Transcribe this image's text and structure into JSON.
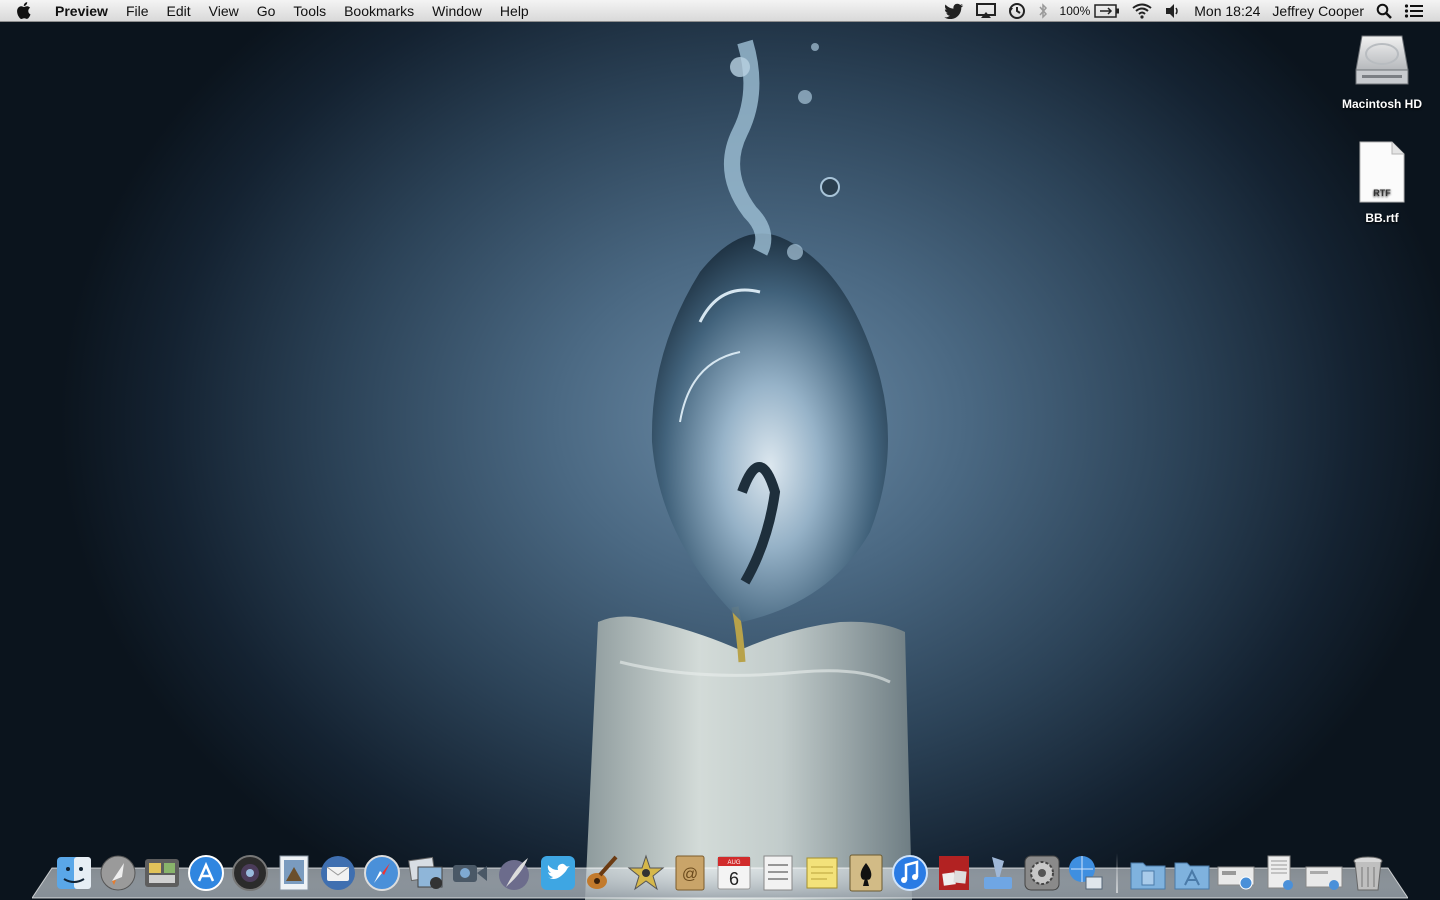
{
  "menubar": {
    "app_name": "Preview",
    "menus": [
      "File",
      "Edit",
      "View",
      "Go",
      "Tools",
      "Bookmarks",
      "Window",
      "Help"
    ],
    "status": {
      "battery_percent": "100%",
      "clock": "Mon 18:24",
      "user": "Jeffrey Cooper"
    },
    "status_icons": [
      "twitter-icon",
      "airplay-icon",
      "time-machine-icon",
      "bluetooth-icon",
      "battery-icon",
      "wifi-icon",
      "volume-icon",
      "spotlight-icon",
      "notification-list-icon"
    ]
  },
  "desktop": {
    "icons": [
      {
        "label": "Macintosh HD",
        "icon": "hard-drive-icon"
      },
      {
        "label": "BB.rtf",
        "icon": "rtf-document-icon",
        "badge": "RTF"
      }
    ]
  },
  "dock": {
    "apps": [
      {
        "name": "finder",
        "color": "#5aa7e8"
      },
      {
        "name": "launchpad",
        "color": "#9a9a9a"
      },
      {
        "name": "dashboard",
        "color": "#6b6b6b"
      },
      {
        "name": "app-store",
        "color": "#2f86e0"
      },
      {
        "name": "aperture",
        "color": "#3a3a3a"
      },
      {
        "name": "preview",
        "color": "#7a9bbf"
      },
      {
        "name": "thunderbird",
        "color": "#3f6fb0"
      },
      {
        "name": "safari",
        "color": "#4a90d9"
      },
      {
        "name": "iphoto",
        "color": "#d8dde3"
      },
      {
        "name": "facetime",
        "color": "#4a5866"
      },
      {
        "name": "quill",
        "color": "#6c6c8c"
      },
      {
        "name": "twitter",
        "color": "#3ea6e3"
      },
      {
        "name": "garageband",
        "color": "#c27a2c"
      },
      {
        "name": "imovie",
        "color": "#d6b84a"
      },
      {
        "name": "address-book",
        "color": "#c9a469"
      },
      {
        "name": "ical",
        "color": "#f4f4f4"
      },
      {
        "name": "reminders",
        "color": "#f2f2f2"
      },
      {
        "name": "stickies",
        "color": "#f3e27a"
      },
      {
        "name": "solitaire",
        "color": "#d2bb86"
      },
      {
        "name": "itunes",
        "color": "#2a7be4"
      },
      {
        "name": "photo-booth",
        "color": "#b22222"
      },
      {
        "name": "preview-2",
        "color": "#6fa6e4"
      },
      {
        "name": "system-preferences",
        "color": "#8a8a8a"
      },
      {
        "name": "network-utility",
        "color": "#3f8fe0"
      },
      {
        "name": "documents-folder",
        "color": "#7fb2de"
      },
      {
        "name": "applications-folder",
        "color": "#7fb2de"
      },
      {
        "name": "downloads-stack",
        "color": "#e9e9e9"
      },
      {
        "name": "documents-stack",
        "color": "#ededed"
      },
      {
        "name": "mail-stack",
        "color": "#e9e9e9"
      },
      {
        "name": "trash",
        "color": "#bfbfbf"
      }
    ],
    "calendar_day": "6",
    "calendar_month": "AUG"
  }
}
